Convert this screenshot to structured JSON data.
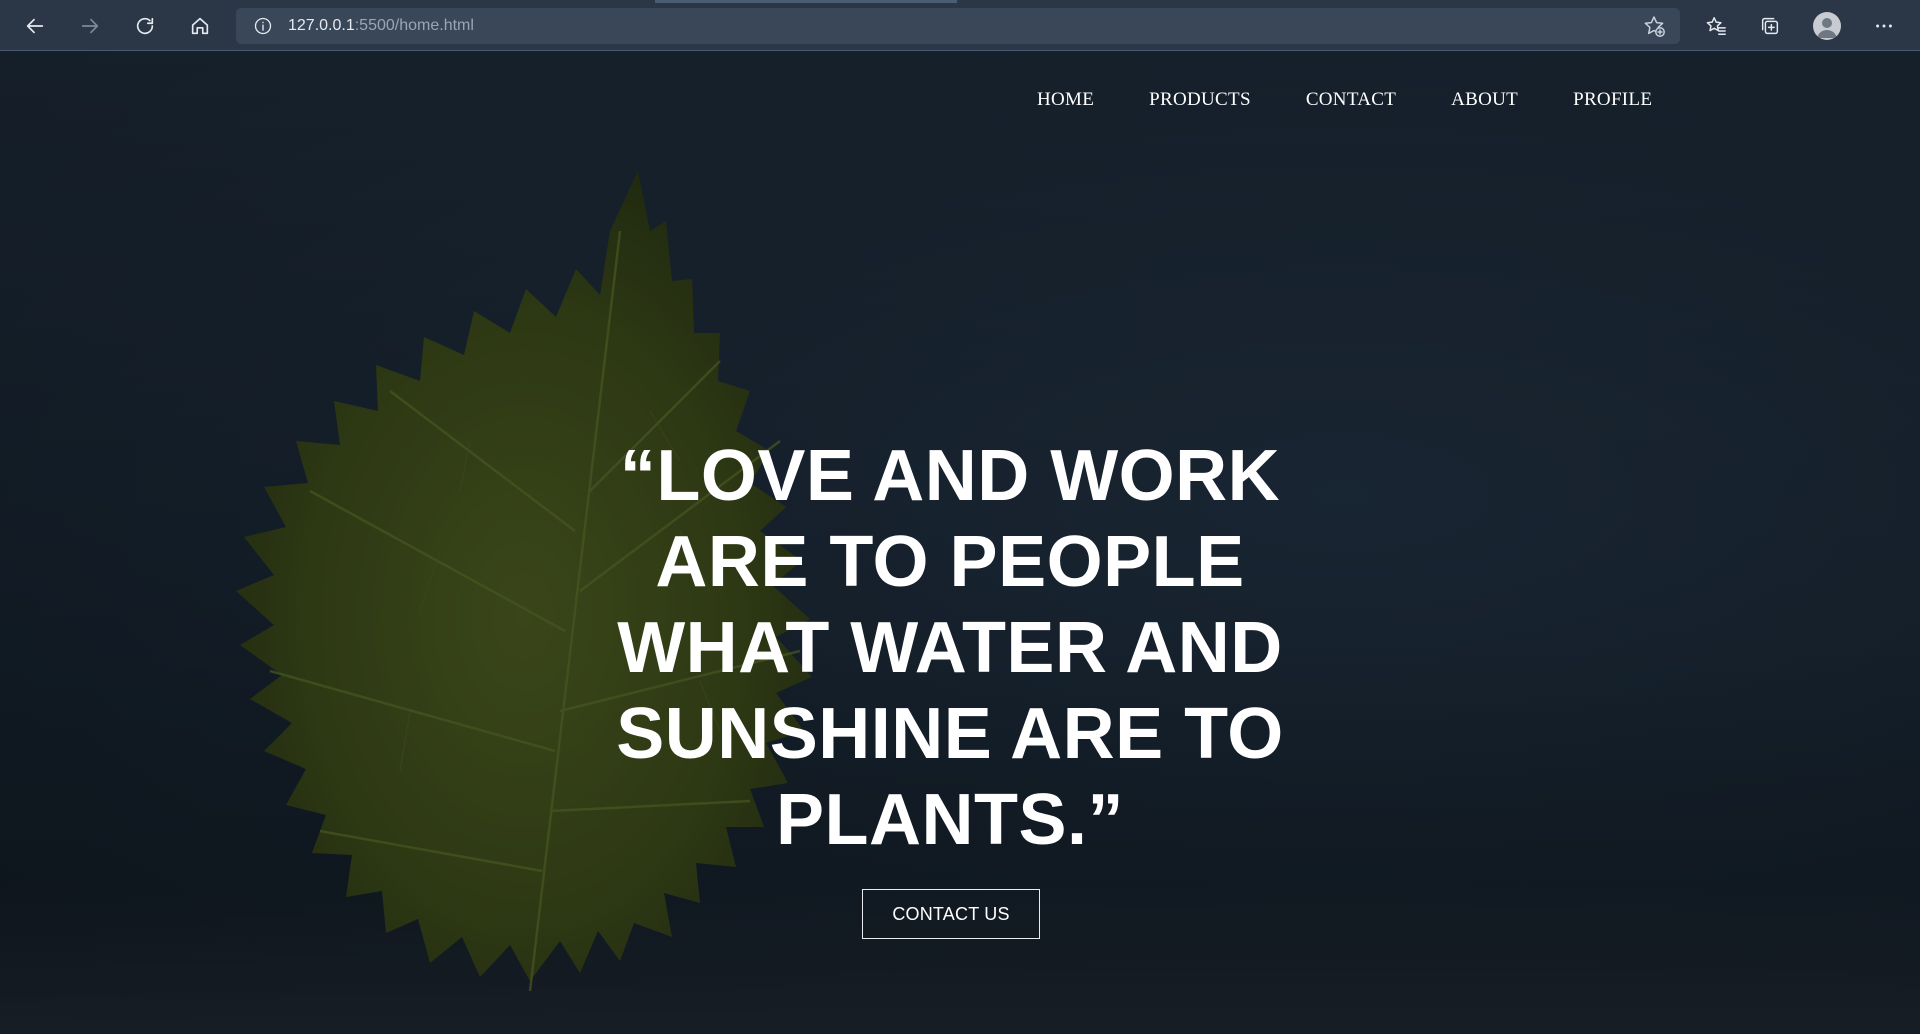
{
  "browser": {
    "url_host": "127.0.0.1",
    "url_path": ":5500/home.html",
    "icons": {
      "back": "back-arrow-icon",
      "forward": "forward-arrow-icon",
      "refresh": "refresh-icon",
      "home": "home-icon",
      "info": "info-icon",
      "favorite_add": "star-add-icon",
      "favorites": "favorites-icon",
      "collections": "collections-icon",
      "profile": "profile-avatar",
      "more": "more-icon"
    }
  },
  "nav": {
    "home": "HOME",
    "products": "PRODUCTS",
    "contact": "CONTACT",
    "about": "ABOUT",
    "profile": "PROFILE"
  },
  "hero": {
    "quote_line1": "“LOVE AND WORK",
    "quote_line2": "ARE TO PEOPLE",
    "quote_line3": "WHAT WATER AND",
    "quote_line4": "SUNSHINE ARE TO",
    "quote_line5": "PLANTS.”",
    "cta_label": "CONTACT US"
  },
  "colors": {
    "chrome": "#2b3747",
    "address_bar": "#3a4759",
    "leaf": "#3d4a14",
    "text": "#ffffff"
  }
}
